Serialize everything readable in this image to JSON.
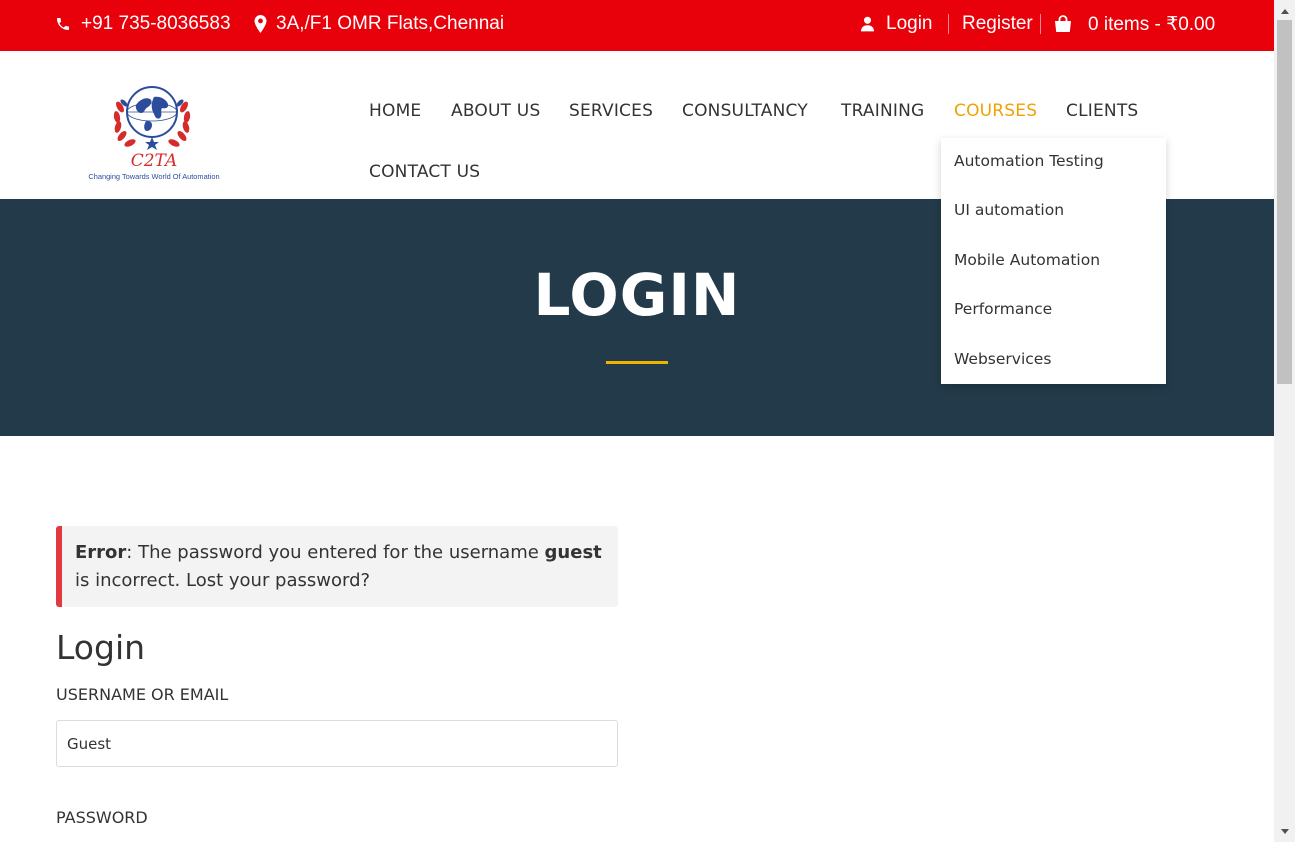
{
  "topbar": {
    "phone": "+91 735-8036583",
    "address": "3A,/F1 OMR Flats,Chennai",
    "login": "Login",
    "register": "Register",
    "cart": "0 items - ₹0.00"
  },
  "logo": {
    "name": "C2TA",
    "tagline": "Changing Towards World Of Automation"
  },
  "nav": {
    "home": "HOME",
    "about": "ABOUT US",
    "services": "SERVICES",
    "consultancy": "CONSULTANCY",
    "training": "TRAINING",
    "courses": "COURSES",
    "clients": "CLIENTS",
    "contact": "CONTACT US"
  },
  "dropdown": {
    "items": [
      "Automation Testing",
      "UI automation",
      "Mobile Automation",
      "Performance",
      "Webservices"
    ]
  },
  "hero": {
    "title": "LOGIN"
  },
  "alert": {
    "label": "Error",
    "text1": ": The password you entered for the username ",
    "username": "guest",
    "text2": " is incorrect. ",
    "link": "Lost your password?"
  },
  "form": {
    "title": "Login",
    "username_label": "USERNAME OR EMAIL",
    "username_value": "Guest",
    "password_label": "PASSWORD"
  },
  "colors": {
    "topbar": "#e8000b",
    "hero": "#233a4a",
    "accent": "#f0a202",
    "error": "#e2383f"
  }
}
